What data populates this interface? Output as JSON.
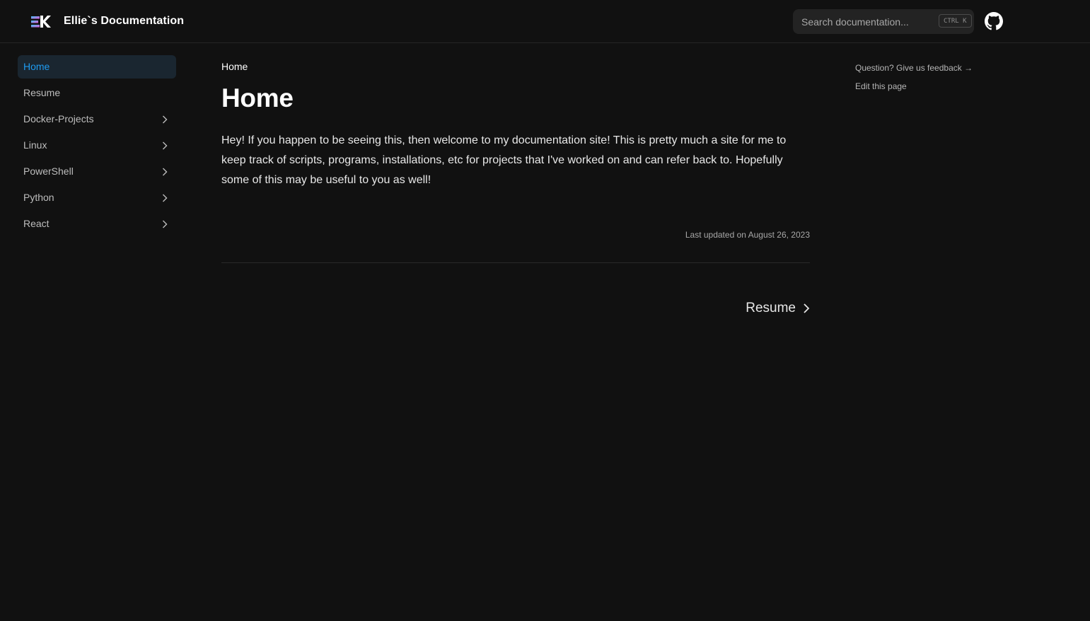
{
  "header": {
    "site_title": "Ellie`s Documentation",
    "logo_icon": "ek-logo-icon",
    "search": {
      "placeholder": "Search documentation...",
      "shortcut": "CTRL K"
    },
    "github_icon": "github-icon"
  },
  "sidebar": {
    "items": [
      {
        "label": "Home",
        "active": true,
        "expandable": false
      },
      {
        "label": "Resume",
        "active": false,
        "expandable": false
      },
      {
        "label": "Docker-Projects",
        "active": false,
        "expandable": true
      },
      {
        "label": "Linux",
        "active": false,
        "expandable": true
      },
      {
        "label": "PowerShell",
        "active": false,
        "expandable": true
      },
      {
        "label": "Python",
        "active": false,
        "expandable": true
      },
      {
        "label": "React",
        "active": false,
        "expandable": true
      }
    ]
  },
  "main": {
    "breadcrumb": "Home",
    "title": "Home",
    "body": "Hey! If you happen to be seeing this, then welcome to my documentation site! This is pretty much a site for me to keep track of scripts, programs, installations, etc for projects that I've worked on and can refer back to. Hopefully some of this may be useful to you as well!",
    "last_updated": "Last updated on August 26, 2023",
    "next_link": "Resume"
  },
  "toc": {
    "feedback": "Question? Give us feedback →",
    "edit": "Edit this page"
  },
  "colors": {
    "background": "#111111",
    "accent": "#1e9bf0",
    "active_bg": "#1a2630"
  }
}
